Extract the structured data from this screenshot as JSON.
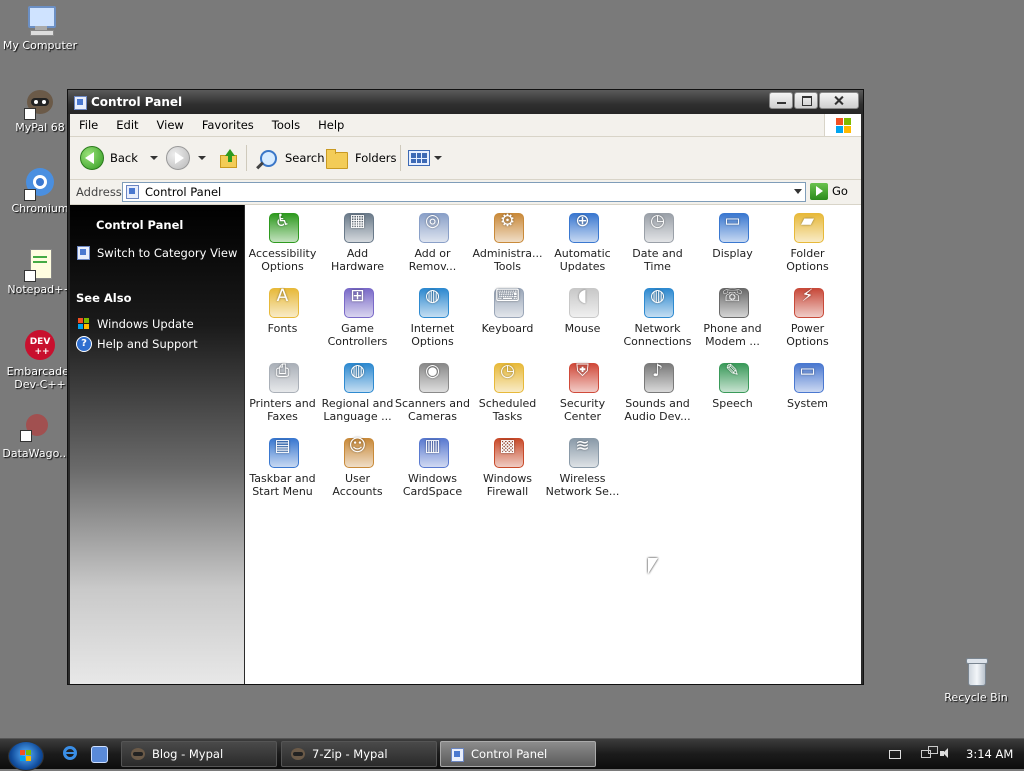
{
  "desktop": {
    "icons": [
      {
        "label": "My Computer"
      },
      {
        "label": "MyPal 68"
      },
      {
        "label": "Chromium"
      },
      {
        "label": "Notepad++"
      },
      {
        "label": "Embarcader\nDev-C++"
      },
      {
        "label": "DataWago..."
      },
      {
        "label": "Recycle Bin"
      }
    ]
  },
  "window": {
    "title": "Control Panel",
    "menu": [
      "File",
      "Edit",
      "View",
      "Favorites",
      "Tools",
      "Help"
    ],
    "toolbar": {
      "back_label": "Back",
      "search_label": "Search",
      "folders_label": "Folders"
    },
    "address": {
      "label": "Address",
      "value": "Control Panel",
      "go_label": "Go"
    },
    "taskpane": {
      "title": "Control Panel",
      "switch_label": "Switch to Category View",
      "see_also_label": "See Also",
      "see_also": [
        {
          "label": "Windows Update"
        },
        {
          "label": "Help and Support"
        }
      ]
    },
    "items": [
      {
        "label": "Accessibility\nOptions",
        "icon": "accessibility-icon"
      },
      {
        "label": "Add\nHardware",
        "icon": "add-hardware-icon"
      },
      {
        "label": "Add or\nRemov...",
        "icon": "add-remove-programs-icon"
      },
      {
        "label": "Administra...\nTools",
        "icon": "administrative-tools-icon"
      },
      {
        "label": "Automatic\nUpdates",
        "icon": "automatic-updates-icon"
      },
      {
        "label": "Date and\nTime",
        "icon": "date-time-icon"
      },
      {
        "label": "Display",
        "icon": "display-icon"
      },
      {
        "label": "Folder\nOptions",
        "icon": "folder-options-icon"
      },
      {
        "label": "Fonts",
        "icon": "fonts-icon"
      },
      {
        "label": "Game\nControllers",
        "icon": "game-controllers-icon"
      },
      {
        "label": "Internet\nOptions",
        "icon": "internet-options-icon"
      },
      {
        "label": "Keyboard",
        "icon": "keyboard-icon"
      },
      {
        "label": "Mouse",
        "icon": "mouse-icon"
      },
      {
        "label": "Network\nConnections",
        "icon": "network-connections-icon"
      },
      {
        "label": "Phone and\nModem ...",
        "icon": "phone-modem-icon"
      },
      {
        "label": "Power\nOptions",
        "icon": "power-options-icon"
      },
      {
        "label": "Printers and\nFaxes",
        "icon": "printers-faxes-icon"
      },
      {
        "label": "Regional and\nLanguage ...",
        "icon": "regional-language-icon"
      },
      {
        "label": "Scanners and\nCameras",
        "icon": "scanners-cameras-icon"
      },
      {
        "label": "Scheduled\nTasks",
        "icon": "scheduled-tasks-icon"
      },
      {
        "label": "Security\nCenter",
        "icon": "security-center-icon"
      },
      {
        "label": "Sounds and\nAudio Dev...",
        "icon": "sounds-audio-icon"
      },
      {
        "label": "Speech",
        "icon": "speech-icon"
      },
      {
        "label": "System",
        "icon": "system-icon"
      },
      {
        "label": "Taskbar and\nStart Menu",
        "icon": "taskbar-start-menu-icon"
      },
      {
        "label": "User\nAccounts",
        "icon": "user-accounts-icon"
      },
      {
        "label": "Windows\nCardSpace",
        "icon": "windows-cardspace-icon"
      },
      {
        "label": "Windows\nFirewall",
        "icon": "windows-firewall-icon"
      },
      {
        "label": "Wireless\nNetwork Se...",
        "icon": "wireless-network-icon"
      }
    ]
  },
  "taskbar": {
    "tasks": [
      {
        "label": "Blog - Mypal"
      },
      {
        "label": "7-Zip - Mypal"
      },
      {
        "label": "Control Panel"
      }
    ],
    "clock": "3:14 AM"
  }
}
